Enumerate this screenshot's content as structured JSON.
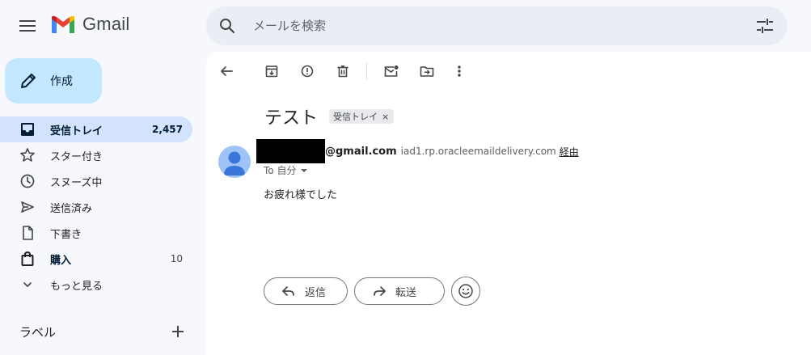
{
  "app": {
    "name": "Gmail",
    "brand_colors": {
      "blue": "#4285f4",
      "red": "#ea4335",
      "yellow": "#fbbc04",
      "green": "#34a853"
    }
  },
  "search": {
    "placeholder": "メールを検索"
  },
  "compose": {
    "label": "作成"
  },
  "sidebar": {
    "items": [
      {
        "label": "受信トレイ",
        "count": "2,457",
        "icon": "inbox-icon",
        "active": true
      },
      {
        "label": "スター付き",
        "count": "",
        "icon": "star-icon"
      },
      {
        "label": "スヌーズ中",
        "count": "",
        "icon": "clock-icon"
      },
      {
        "label": "送信済み",
        "count": "",
        "icon": "send-icon"
      },
      {
        "label": "下書き",
        "count": "",
        "icon": "draft-icon"
      },
      {
        "label": "購入",
        "count": "10",
        "icon": "shopping-bag-icon",
        "bold": true
      },
      {
        "label": "もっと見る",
        "count": "",
        "icon": "chevron-down-icon"
      }
    ],
    "labels_title": "ラベル"
  },
  "email": {
    "subject": "テスト",
    "label_chip": "受信トレイ",
    "label_chip_close": "×",
    "sender_domain": "@gmail.com",
    "via_domain": "iad1.rp.oracleemaildelivery.com",
    "via_text": "経由",
    "to_text": "To 自分",
    "body": "お疲れ様でした"
  },
  "actions": {
    "reply": "返信",
    "forward": "転送"
  },
  "colors": {
    "page_bg": "#f6f8fc",
    "compose_bg": "#c2e7ff",
    "active_nav_bg": "#d3e3fd",
    "search_bg": "#e9eef6",
    "avatar_bg": "#a0c3f7"
  }
}
